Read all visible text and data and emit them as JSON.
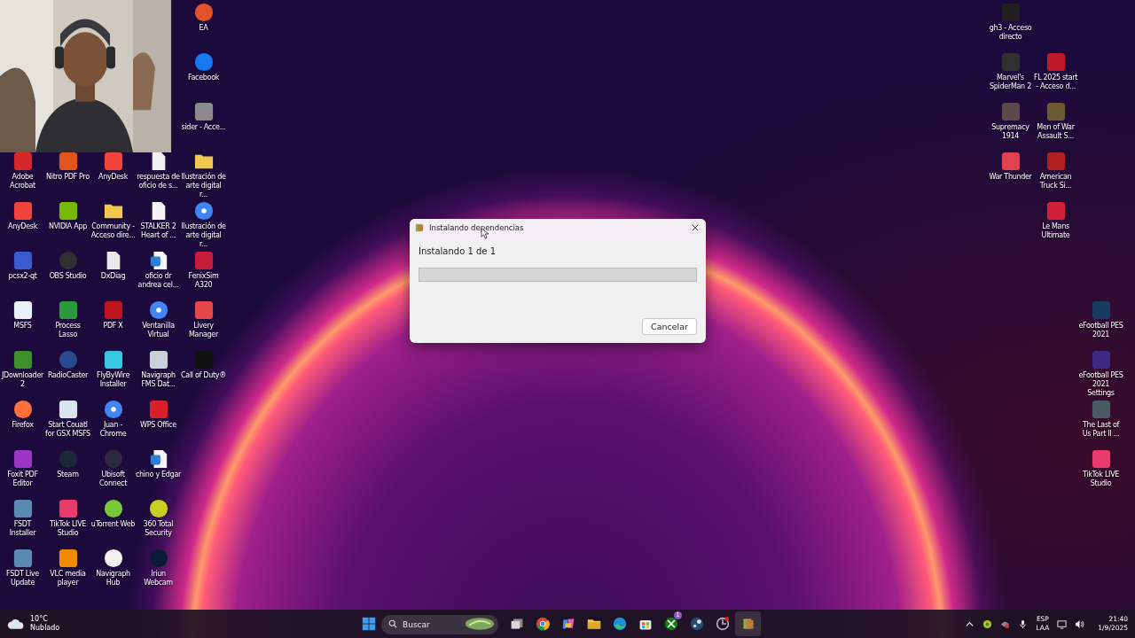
{
  "desktop": {
    "left_columns": [
      {
        "items": [
          {
            "label": "Adobe Acrobat",
            "kind": "app",
            "color": "#d7262a"
          },
          {
            "label": "AnyDesk",
            "kind": "app",
            "color": "#ef443b"
          },
          {
            "label": "pcsx2-qt",
            "kind": "app",
            "color": "#3a5bd0"
          },
          {
            "label": "MSFS",
            "kind": "app",
            "color": "#e8f0f8"
          },
          {
            "label": "JDownloader 2",
            "kind": "app",
            "color": "#3f8f2a"
          },
          {
            "label": "Firefox",
            "kind": "round",
            "color": "#ff7139"
          },
          {
            "label": "Foxit PDF Editor",
            "kind": "app",
            "color": "#9b35c4"
          },
          {
            "label": "FSDT Installer",
            "kind": "app",
            "color": "#5a8ab0"
          },
          {
            "label": "FSDT Live Update",
            "kind": "app",
            "color": "#5a8ab0"
          }
        ]
      },
      {
        "items": [
          {
            "label": "Nitro PDF Pro",
            "kind": "app",
            "color": "#e2541b"
          },
          {
            "label": "NVIDIA App",
            "kind": "app",
            "color": "#76b900"
          },
          {
            "label": "OBS Studio",
            "kind": "round",
            "color": "#303030"
          },
          {
            "label": "Process Lasso",
            "kind": "app",
            "color": "#2a9a3a"
          },
          {
            "label": "RadioCaster",
            "kind": "round",
            "color": "#2a4a90"
          },
          {
            "label": "Start Couatl for GSX MSFS",
            "kind": "app",
            "color": "#d8e4f0"
          },
          {
            "label": "Steam",
            "kind": "round",
            "color": "#1b2838"
          },
          {
            "label": "TikTok LIVE Studio",
            "kind": "app",
            "color": "#e83b6a"
          },
          {
            "label": "VLC media player",
            "kind": "app",
            "color": "#f08a00"
          }
        ]
      },
      {
        "items": [
          {
            "label": "AnyDesk",
            "kind": "app",
            "color": "#ef443b"
          },
          {
            "label": "Community - Acceso dire...",
            "kind": "folder",
            "color": "#f2c94c"
          },
          {
            "label": "DxDiag",
            "kind": "document",
            "color": "#e8e8e8"
          },
          {
            "label": "PDF X",
            "kind": "app",
            "color": "#c0141c"
          },
          {
            "label": "FlyByWire Installer",
            "kind": "app",
            "color": "#38c6e0"
          },
          {
            "label": "Juan - Chrome",
            "kind": "web",
            "color": "#4285f4"
          },
          {
            "label": "Ubisoft Connect",
            "kind": "round",
            "color": "#2a2a40"
          },
          {
            "label": "uTorrent Web",
            "kind": "round",
            "color": "#78c83a"
          },
          {
            "label": "Navigraph Hub",
            "kind": "round",
            "color": "#f0f0f0"
          }
        ]
      },
      {
        "items": [
          {
            "label": "respuesta de oficio de s...",
            "kind": "document",
            "color": "#f0f0f0"
          },
          {
            "label": "STALKER 2 Heart of ...",
            "kind": "document",
            "color": "#f4f4f4"
          },
          {
            "label": "oficio dr andrea cel...",
            "kind": "word",
            "color": "#2b7cd3"
          },
          {
            "label": "Ventanilla Virtual",
            "kind": "web",
            "color": "#4285f5"
          },
          {
            "label": "Navigraph FMS Dat...",
            "kind": "app",
            "color": "#c8d0d8"
          },
          {
            "label": "WPS Office",
            "kind": "app",
            "color": "#d8202a"
          },
          {
            "label": "chino y Edgar",
            "kind": "word",
            "color": "#2b7cd4"
          },
          {
            "label": "360 Total Security",
            "kind": "round",
            "color": "#c8d020"
          },
          {
            "label": "Iriun Webcam",
            "kind": "round",
            "color": "#0c1a3a"
          }
        ]
      },
      {
        "items": [
          {
            "label": "EA",
            "kind": "round",
            "color": "#e5522a"
          },
          {
            "label": "Facebook",
            "kind": "round",
            "color": "#1877f2"
          },
          {
            "label": "sider - Acce...",
            "kind": "app",
            "color": "#8a8a8a"
          },
          {
            "label": "Ilustración de arte digital r...",
            "kind": "folder",
            "color": "#f2c94d"
          },
          {
            "label": "Ilustración de arte digital r...",
            "kind": "web",
            "color": "#4285f6"
          },
          {
            "label": "FenixSim A320",
            "kind": "app",
            "color": "#c81d3a"
          },
          {
            "label": "Livery Manager",
            "kind": "app",
            "color": "#e8474a"
          },
          {
            "label": "Call of Duty®",
            "kind": "app",
            "color": "#111111"
          }
        ]
      }
    ],
    "right_columns": [
      {
        "items": [
          {
            "label": "gh3 - Acceso directo",
            "kind": "app",
            "color": "#202020"
          },
          {
            "label": "Marvel's SpiderMan 2",
            "kind": "app",
            "color": "#303030"
          },
          {
            "label": "Supremacy 1914",
            "kind": "app",
            "color": "#5a4a4a"
          },
          {
            "label": "War Thunder",
            "kind": "app",
            "color": "#e04050"
          }
        ]
      },
      {
        "items": [
          {
            "label": "FL 2025 start - Acceso d...",
            "kind": "app",
            "color": "#c01a2a"
          },
          {
            "label": "Men of War Assault S...",
            "kind": "app",
            "color": "#6a5a30"
          },
          {
            "label": "American Truck Si...",
            "kind": "app",
            "color": "#b02020"
          },
          {
            "label": "Le Mans Ultimate",
            "kind": "app",
            "color": "#d0203a"
          }
        ]
      },
      {
        "items": [
          {
            "label": "eFootball PES 2021",
            "kind": "app",
            "color": "#1a3a60"
          },
          {
            "label": "eFootball PES 2021 Settings",
            "kind": "app",
            "color": "#3a2a80"
          },
          {
            "label": "The Last of Us Part II ...",
            "kind": "app",
            "color": "#4a5a60"
          },
          {
            "label": "TikTok LIVE Studio",
            "kind": "app",
            "color": "#e83b6b"
          }
        ]
      }
    ]
  },
  "dialog": {
    "title": "Instalando dependencias",
    "message": "Instalando 1 de 1",
    "progress": {
      "level": 0
    },
    "buttons": [
      "Cancelar"
    ]
  },
  "taskbar": {
    "weather": {
      "temperature": "10°C",
      "condition": "Nublado"
    },
    "search": {
      "placeholder": "Buscar"
    },
    "apps": [
      {
        "kind": "task-view",
        "active": false
      },
      {
        "kind": "chrome",
        "active": false
      },
      {
        "kind": "copilot",
        "active": false
      },
      {
        "kind": "explorer",
        "active": false
      },
      {
        "kind": "edge",
        "active": false
      },
      {
        "kind": "store",
        "active": false
      },
      {
        "kind": "xbox",
        "active": false,
        "badge": "1"
      },
      {
        "kind": "steam",
        "active": false
      },
      {
        "kind": "app",
        "active": false
      },
      {
        "kind": "installer",
        "active": true
      }
    ],
    "tray": {
      "language": "ESP",
      "layout": "LAA",
      "time": "21:40",
      "date": "1/9/2025"
    }
  }
}
